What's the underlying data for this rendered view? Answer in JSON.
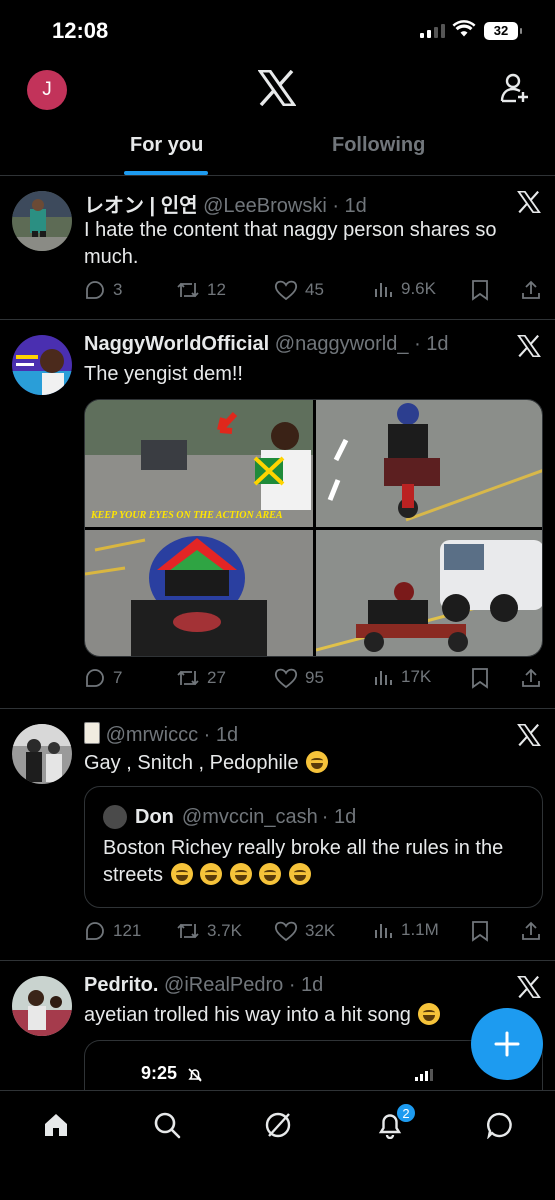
{
  "status_bar": {
    "time": "12:08",
    "battery": "32"
  },
  "header": {
    "avatar_letter": "J"
  },
  "tabs": [
    {
      "label": "For you",
      "active": true
    },
    {
      "label": "Following",
      "active": false
    }
  ],
  "posts": [
    {
      "name": "レオン | 인연",
      "handle": "@LeeBrowski",
      "time": "· 1d",
      "text": "I hate the content that naggy person shares so much.",
      "replies": "3",
      "reposts": "12",
      "likes": "45",
      "views": "9.6K"
    },
    {
      "name": "NaggyWorldOfficial",
      "handle": "@naggyworld_",
      "time": "· 1d",
      "text": "The yengist dem!!",
      "media_caption": "KEEP YOUR EYES ON THE ACTION AREA",
      "replies": "7",
      "reposts": "27",
      "likes": "95",
      "views": "17K"
    },
    {
      "name": "",
      "handle": "@mrwiccc",
      "time": "· 1d",
      "text": "Gay , Snitch , Pedophile",
      "quote": {
        "name": "Don",
        "handle": "@mvccin_cash",
        "time": "· 1d",
        "text": "Boston Richey really broke all the rules in the streets"
      },
      "replies": "121",
      "reposts": "3.7K",
      "likes": "32K",
      "views": "1.1M"
    },
    {
      "name": "Pedrito.",
      "handle": "@iRealPedro",
      "time": "· 1d",
      "text": "ayetian trolled his way into a hit song",
      "embed_time": "9:25"
    }
  ],
  "nav": {
    "notifications_badge": "2"
  },
  "colors": {
    "accent": "#1d9bf0",
    "muted": "#71767b",
    "divider": "#2f3336"
  }
}
